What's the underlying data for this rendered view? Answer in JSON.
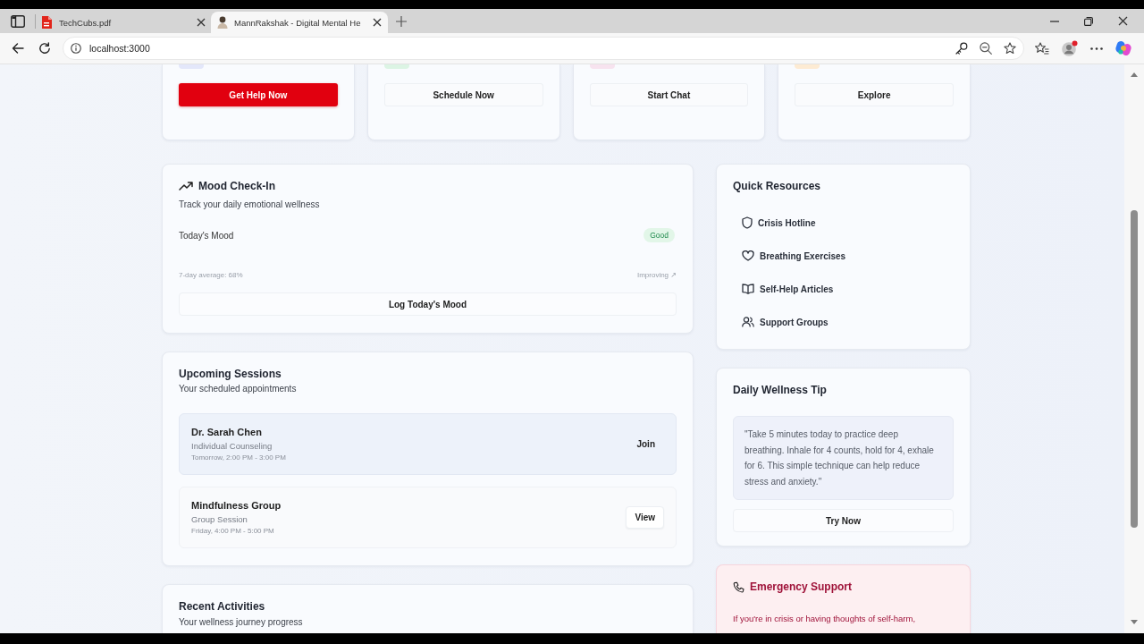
{
  "browser": {
    "tabs": [
      {
        "title": "TechCubs.pdf",
        "selected": false
      },
      {
        "title": "MannRakshak - Digital Mental He",
        "selected": true
      }
    ],
    "address": "localhost:3000"
  },
  "action_cards": [
    {
      "color": "#e3e7fa",
      "button": "Get Help Now",
      "kind": "primary"
    },
    {
      "color": "#dcf4e4",
      "button": "Schedule Now",
      "kind": "outline"
    },
    {
      "color": "#f7e3ef",
      "button": "Start Chat",
      "kind": "outline"
    },
    {
      "color": "#fdebd3",
      "button": "Explore",
      "kind": "outline"
    }
  ],
  "mood_check_in": {
    "title": "Mood Check-In",
    "subtitle": "Track your daily emotional wellness",
    "label": "Today's Mood",
    "mood": "Good",
    "average": "7-day average: 68%",
    "trend": "Improving ↗",
    "button": "Log Today's Mood"
  },
  "sessions": {
    "title": "Upcoming Sessions",
    "subtitle": "Your scheduled appointments",
    "items": [
      {
        "name": "Dr. Sarah Chen",
        "type": "Individual Counseling",
        "time": "Tomorrow, 2:00 PM - 3:00 PM",
        "action": "Join",
        "highlighted": true
      },
      {
        "name": "Mindfulness Group",
        "type": "Group Session",
        "time": "Friday, 4:00 PM - 5:00 PM",
        "action": "View",
        "highlighted": false
      }
    ]
  },
  "recent_activities": {
    "title": "Recent Activities",
    "subtitle": "Your wellness journey progress"
  },
  "quick_resources": {
    "title": "Quick Resources",
    "items": [
      {
        "label": "Crisis Hotline"
      },
      {
        "label": "Breathing Exercises"
      },
      {
        "label": "Self-Help Articles"
      },
      {
        "label": "Support Groups"
      }
    ]
  },
  "wellness_tip": {
    "title": "Daily Wellness Tip",
    "quote": "\"Take 5 minutes today to practice deep breathing. Inhale for 4 counts, hold for 4, exhale for 6. This simple technique can help reduce stress and anxiety.\"",
    "button": "Try Now"
  },
  "emergency": {
    "title": "Emergency Support",
    "text": "If you're in crisis or having thoughts of self-harm,"
  }
}
